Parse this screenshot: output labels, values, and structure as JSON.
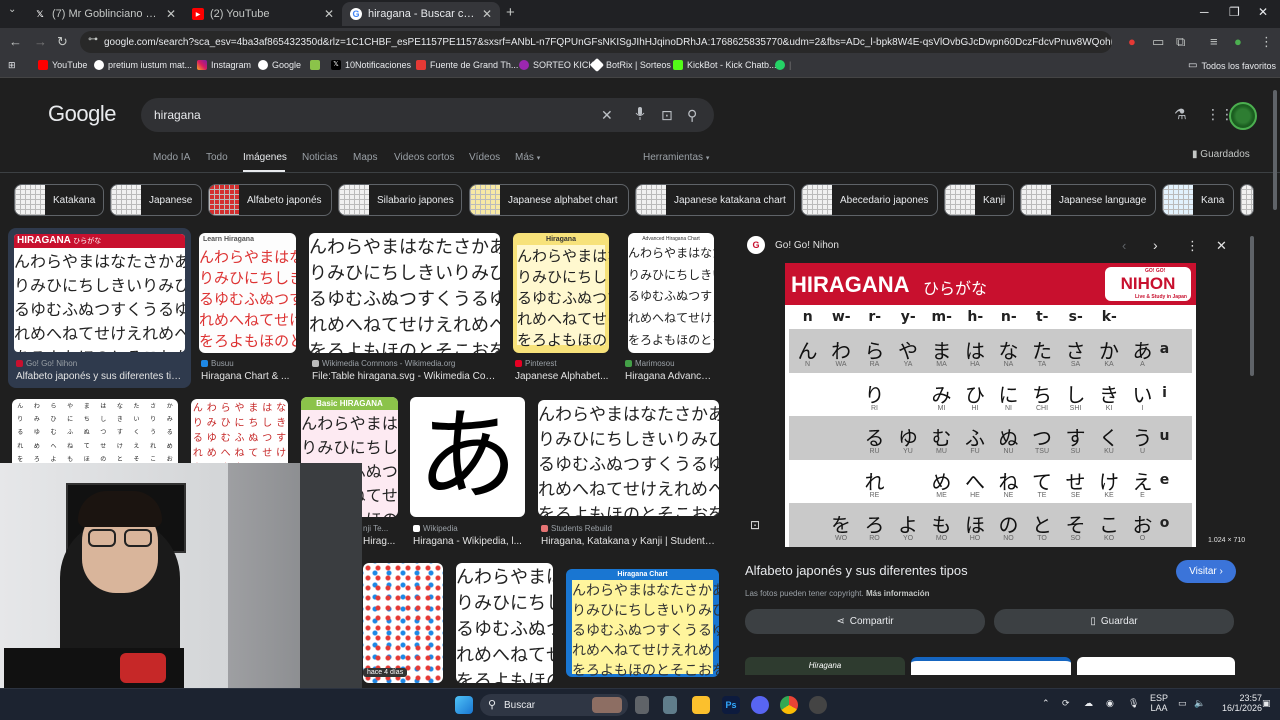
{
  "browser": {
    "tabs": [
      {
        "title": "(7) Mr Goblinciano (@MGoblin",
        "favicon": "x-icon"
      },
      {
        "title": "(2) YouTube",
        "favicon": "youtube-icon"
      },
      {
        "title": "hiragana - Buscar con Google",
        "favicon": "google-icon",
        "active": true
      }
    ],
    "url": "google.com/search?sca_esv=4ba3af865432350d&rlz=1C1CHBF_esPE1157PE1157&sxsrf=ANbL-n7FQPUnGFsNKISgJIhHJqinoDRhJA:1768625835770&udm=2&fbs=ADc_l-bpk8W4E-qsVlOvbGJcDwpn60DczFdcvPnuv8WQohHLTbSVldBrj9m...",
    "bookmarks": [
      "YouTube",
      "pretium iustum mat...",
      "Instagram",
      "Google",
      "",
      "10Notificaciones",
      "Fuente de Grand Th...",
      "SORTEO KICK",
      "BotRix | Sorteos",
      "KickBot - Kick Chatb...",
      ""
    ],
    "all_bookmarks": "Todos los favoritos"
  },
  "google": {
    "logo": "Google",
    "query": "hiragana",
    "nav": [
      "Modo IA",
      "Todo",
      "Imágenes",
      "Noticias",
      "Maps",
      "Videos cortos",
      "Vídeos",
      "Más"
    ],
    "tools": "Herramientas",
    "saved": "Guardados",
    "chips": [
      "Katakana",
      "Japanese",
      "Alfabeto japonés",
      "Silabario japones",
      "Japanese alphabet chart",
      "Japanese katakana chart",
      "Abecedario japones",
      "Kanji",
      "Japanese language",
      "Kana"
    ]
  },
  "results": [
    {
      "source": "Go! Go! Nihon",
      "caption": "Alfabeto japonés y sus diferentes tipos"
    },
    {
      "source": "Busuu",
      "caption": "Hiragana Chart & ..."
    },
    {
      "source": "Wikimedia Commons - Wikimedia.org",
      "caption": "File:Table hiragana.svg - Wikimedia Com..."
    },
    {
      "source": "Pinterest",
      "caption": "Japanese Alphabet..."
    },
    {
      "source": "Marimosou",
      "caption": "Hiragana Advance..."
    },
    {
      "source": "Wikipedia",
      "caption": "Hiragana - Wikipedia, l..."
    },
    {
      "source": "Students Rebuild",
      "caption": "Hiragana, Katakana y Kanji | Students ..."
    },
    {
      "source": "nji Te...",
      "caption": "Hirag..."
    }
  ],
  "thumb_labels": {
    "hiragana": "HIRAGANA",
    "hiragana_kana": "ひらがな",
    "learn": "Learn Hiragana",
    "basic": "Basic HIRAGANA",
    "hiragana_small": "Hiragana",
    "advanced": "Advanced Hiragana Chart",
    "chart": "Hiragana Chart",
    "big_a": "あ",
    "badge": "hace 4 días"
  },
  "kana_rows": [
    "んわらやまはなたさかあ",
    "りみひにちしきい",
    "るゆむふぬつすくう",
    "れめへねてせけえ",
    "をろよもほのとそこお"
  ],
  "preview": {
    "site": "Go! Go! Nihon",
    "title": "HIRAGANA",
    "title_kana": "ひらがな",
    "logo_top": "GO! GO!",
    "logo": "NIHON",
    "logo_sub": "Live & Study in Japan",
    "columns": [
      "n",
      "w-",
      "r-",
      "y-",
      "m-",
      "h-",
      "n-",
      "t-",
      "s-",
      "k-",
      ""
    ],
    "rows": [
      {
        "vowel": "a",
        "chars": [
          "ん",
          "わ",
          "ら",
          "や",
          "ま",
          "は",
          "な",
          "た",
          "さ",
          "か",
          "あ"
        ],
        "romaji": [
          "N",
          "WA",
          "RA",
          "YA",
          "MA",
          "HA",
          "NA",
          "TA",
          "SA",
          "KA",
          "A"
        ]
      },
      {
        "vowel": "i",
        "chars": [
          "",
          "",
          "り",
          "",
          "み",
          "ひ",
          "に",
          "ち",
          "し",
          "き",
          "い"
        ],
        "romaji": [
          "",
          "",
          "RI",
          "",
          "MI",
          "HI",
          "NI",
          "CHI",
          "SHI",
          "KI",
          "I"
        ]
      },
      {
        "vowel": "u",
        "chars": [
          "",
          "",
          "る",
          "ゆ",
          "む",
          "ふ",
          "ぬ",
          "つ",
          "す",
          "く",
          "う"
        ],
        "romaji": [
          "",
          "",
          "RU",
          "YU",
          "MU",
          "FU",
          "NU",
          "TSU",
          "SU",
          "KU",
          "U"
        ]
      },
      {
        "vowel": "e",
        "chars": [
          "",
          "",
          "れ",
          "",
          "め",
          "へ",
          "ね",
          "て",
          "せ",
          "け",
          "え"
        ],
        "romaji": [
          "",
          "",
          "RE",
          "",
          "ME",
          "HE",
          "NE",
          "TE",
          "SE",
          "KE",
          "E"
        ]
      },
      {
        "vowel": "o",
        "chars": [
          "",
          "を",
          "ろ",
          "よ",
          "も",
          "ほ",
          "の",
          "と",
          "そ",
          "こ",
          "お"
        ],
        "romaji": [
          "",
          "WO",
          "RO",
          "YO",
          "MO",
          "HO",
          "NO",
          "TO",
          "SO",
          "KO",
          "O"
        ]
      }
    ],
    "dimensions": "1.024 × 710",
    "caption": "Alfabeto japonés y sus diferentes tipos",
    "visit": "Visitar",
    "copyright": "Las fotos pueden tener copyright.",
    "more_info": "Más información",
    "share": "Compartir",
    "save": "Guardar",
    "below_thumb": "Hiragana"
  },
  "taskbar": {
    "search": "Buscar",
    "lang_top": "ESP",
    "lang_bottom": "LAA",
    "time": "23:57",
    "date": "16/1/2026"
  },
  "colors": {
    "accent": "#3b74d9",
    "brand_red": "#c8102e",
    "background": "#1f1f1f"
  }
}
